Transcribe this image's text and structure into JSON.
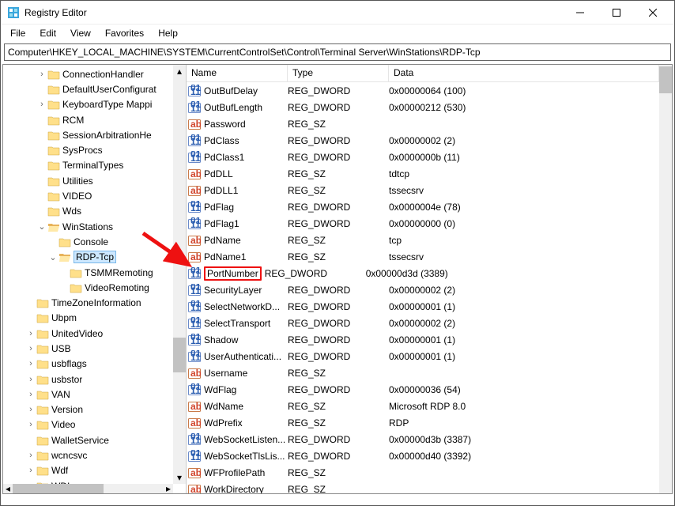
{
  "window": {
    "title": "Registry Editor"
  },
  "menu": {
    "file": "File",
    "edit": "Edit",
    "view": "View",
    "favorites": "Favorites",
    "help": "Help"
  },
  "address": {
    "path": "Computer\\HKEY_LOCAL_MACHINE\\SYSTEM\\CurrentControlSet\\Control\\Terminal Server\\WinStations\\RDP-Tcp"
  },
  "tree": [
    {
      "ind": 3,
      "twisty": ">",
      "label": "ConnectionHandler",
      "open": false
    },
    {
      "ind": 3,
      "twisty": "",
      "label": "DefaultUserConfigurat",
      "open": false
    },
    {
      "ind": 3,
      "twisty": ">",
      "label": "KeyboardType Mappi",
      "open": false
    },
    {
      "ind": 3,
      "twisty": "",
      "label": "RCM",
      "open": false
    },
    {
      "ind": 3,
      "twisty": "",
      "label": "SessionArbitrationHe",
      "open": false
    },
    {
      "ind": 3,
      "twisty": "",
      "label": "SysProcs",
      "open": false
    },
    {
      "ind": 3,
      "twisty": "",
      "label": "TerminalTypes",
      "open": false
    },
    {
      "ind": 3,
      "twisty": "",
      "label": "Utilities",
      "open": false
    },
    {
      "ind": 3,
      "twisty": "",
      "label": "VIDEO",
      "open": false
    },
    {
      "ind": 3,
      "twisty": "",
      "label": "Wds",
      "open": false
    },
    {
      "ind": 3,
      "twisty": "v",
      "label": "WinStations",
      "open": true
    },
    {
      "ind": 4,
      "twisty": "",
      "label": "Console",
      "open": false
    },
    {
      "ind": 4,
      "twisty": "v",
      "label": "RDP-Tcp",
      "open": true,
      "selected": true
    },
    {
      "ind": 5,
      "twisty": "",
      "label": "TSMMRemoting",
      "open": false
    },
    {
      "ind": 5,
      "twisty": "",
      "label": "VideoRemoting",
      "open": false
    },
    {
      "ind": 2,
      "twisty": "",
      "label": "TimeZoneInformation",
      "open": false
    },
    {
      "ind": 2,
      "twisty": "",
      "label": "Ubpm",
      "open": false
    },
    {
      "ind": 2,
      "twisty": ">",
      "label": "UnitedVideo",
      "open": false
    },
    {
      "ind": 2,
      "twisty": ">",
      "label": "USB",
      "open": false
    },
    {
      "ind": 2,
      "twisty": ">",
      "label": "usbflags",
      "open": false
    },
    {
      "ind": 2,
      "twisty": ">",
      "label": "usbstor",
      "open": false
    },
    {
      "ind": 2,
      "twisty": ">",
      "label": "VAN",
      "open": false
    },
    {
      "ind": 2,
      "twisty": ">",
      "label": "Version",
      "open": false
    },
    {
      "ind": 2,
      "twisty": ">",
      "label": "Video",
      "open": false
    },
    {
      "ind": 2,
      "twisty": "",
      "label": "WalletService",
      "open": false
    },
    {
      "ind": 2,
      "twisty": ">",
      "label": "wcncsvc",
      "open": false
    },
    {
      "ind": 2,
      "twisty": ">",
      "label": "Wdf",
      "open": false
    },
    {
      "ind": 2,
      "twisty": ">",
      "label": "WDI",
      "open": false
    }
  ],
  "columns": {
    "name": "Name",
    "type": "Type",
    "data": "Data"
  },
  "values": [
    {
      "icon": "bin",
      "name": "OutBufDelay",
      "type": "REG_DWORD",
      "data": "0x00000064 (100)"
    },
    {
      "icon": "bin",
      "name": "OutBufLength",
      "type": "REG_DWORD",
      "data": "0x00000212 (530)"
    },
    {
      "icon": "str",
      "name": "Password",
      "type": "REG_SZ",
      "data": ""
    },
    {
      "icon": "bin",
      "name": "PdClass",
      "type": "REG_DWORD",
      "data": "0x00000002 (2)"
    },
    {
      "icon": "bin",
      "name": "PdClass1",
      "type": "REG_DWORD",
      "data": "0x0000000b (11)"
    },
    {
      "icon": "str",
      "name": "PdDLL",
      "type": "REG_SZ",
      "data": "tdtcp"
    },
    {
      "icon": "str",
      "name": "PdDLL1",
      "type": "REG_SZ",
      "data": "tssecsrv"
    },
    {
      "icon": "bin",
      "name": "PdFlag",
      "type": "REG_DWORD",
      "data": "0x0000004e (78)"
    },
    {
      "icon": "bin",
      "name": "PdFlag1",
      "type": "REG_DWORD",
      "data": "0x00000000 (0)"
    },
    {
      "icon": "str",
      "name": "PdName",
      "type": "REG_SZ",
      "data": "tcp"
    },
    {
      "icon": "str",
      "name": "PdName1",
      "type": "REG_SZ",
      "data": "tssecsrv"
    },
    {
      "icon": "bin",
      "name": "PortNumber",
      "type": "REG_DWORD",
      "data": "0x00000d3d (3389)",
      "highlight": true
    },
    {
      "icon": "bin",
      "name": "SecurityLayer",
      "type": "REG_DWORD",
      "data": "0x00000002 (2)"
    },
    {
      "icon": "bin",
      "name": "SelectNetworkD...",
      "type": "REG_DWORD",
      "data": "0x00000001 (1)"
    },
    {
      "icon": "bin",
      "name": "SelectTransport",
      "type": "REG_DWORD",
      "data": "0x00000002 (2)"
    },
    {
      "icon": "bin",
      "name": "Shadow",
      "type": "REG_DWORD",
      "data": "0x00000001 (1)"
    },
    {
      "icon": "bin",
      "name": "UserAuthenticati...",
      "type": "REG_DWORD",
      "data": "0x00000001 (1)"
    },
    {
      "icon": "str",
      "name": "Username",
      "type": "REG_SZ",
      "data": ""
    },
    {
      "icon": "bin",
      "name": "WdFlag",
      "type": "REG_DWORD",
      "data": "0x00000036 (54)"
    },
    {
      "icon": "str",
      "name": "WdName",
      "type": "REG_SZ",
      "data": "Microsoft RDP 8.0"
    },
    {
      "icon": "str",
      "name": "WdPrefix",
      "type": "REG_SZ",
      "data": "RDP"
    },
    {
      "icon": "bin",
      "name": "WebSocketListen...",
      "type": "REG_DWORD",
      "data": "0x00000d3b (3387)"
    },
    {
      "icon": "bin",
      "name": "WebSocketTlsLis...",
      "type": "REG_DWORD",
      "data": "0x00000d40 (3392)"
    },
    {
      "icon": "str",
      "name": "WFProfilePath",
      "type": "REG_SZ",
      "data": ""
    },
    {
      "icon": "str",
      "name": "WorkDirectory",
      "type": "REG_SZ",
      "data": ""
    }
  ]
}
